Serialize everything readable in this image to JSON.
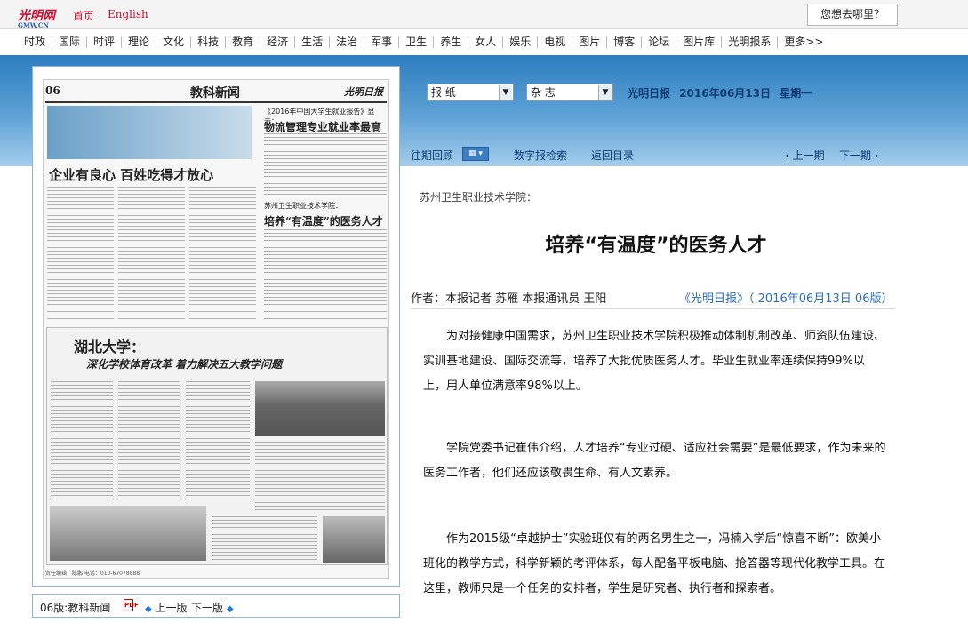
{
  "topbar": {
    "logo_text": "光明网",
    "logo_sub": "GMW.CN",
    "home_label": "首页",
    "english_label": "English",
    "search_label": "您想去哪里？"
  },
  "nav": {
    "items": [
      "时政",
      "国际",
      "时评",
      "理论",
      "文化",
      "科技",
      "教育",
      "经济",
      "生活",
      "法治",
      "军事",
      "卫生",
      "养生",
      "女人",
      "娱乐",
      "电视",
      "图片",
      "博客",
      "论坛",
      "图片库",
      "光明报系",
      "更多>>"
    ]
  },
  "paper": {
    "page_no": "06",
    "section": "教科新闻",
    "masthead": "光明日报",
    "headline1": "企业有良心 百姓吃得才放心",
    "sub2": "《2016年中国大学生就业报告》显示：",
    "headline2": "物流管理专业就业率最高",
    "sub3": "苏州卫生职业技术学院：",
    "headline3": "培养“有温度”的医务人才",
    "hubei_title": "湖北大学：",
    "hubei_sub": "深化学校体育改革  着力解决五大教学问题",
    "footer": "责任编辑：陈鹏 电话：010-67078888"
  },
  "paper_nav": {
    "label": "06版:教科新闻",
    "pdf_icon": "PDF",
    "prev_label": "上一版",
    "next_label": "下一版"
  },
  "selectors": {
    "paper_value": "报 纸",
    "magazine_value": "杂 志"
  },
  "issue": {
    "name": "光明日报",
    "date": "2016年06月13日",
    "weekday": "星期一"
  },
  "toolbar": {
    "past_label": "往期回顾",
    "search_label": "数字报检索",
    "index_label": "返回目录",
    "prev_label": "上一期",
    "next_label": "下一期"
  },
  "article": {
    "kicker": "苏州卫生职业技术学院：",
    "title": "培养“有温度”的医务人才",
    "byline": "作者：本报记者 苏雁 本报通讯员 王阳",
    "source": "《光明日报》（ 2016年06月13日 06版）",
    "paragraphs": [
      "为对接健康中国需求，苏州卫生职业技术学院积极推动体制机制改革、师资队伍建设、实训基地建设、国际交流等，培养了大批优质医务人才。毕业生就业率连续保持99%以上，用人单位满意率98%以上。",
      "学院党委书记崔伟介绍，人才培养“专业过硬、适应社会需要”是最低要求，作为未来的医务工作者，他们还应该敬畏生命、有人文素养。",
      "作为2015级“卓越护士”实验班仅有的两名男生之一，冯楠入学后“惊喜不断”：欧美小班化的教学方式，科学新颖的考评体系，每人配备平板电脑、抢答器等现代化教学工具。在这里，教师只是一个任务的安排者，学生是研究者、执行者和探索者。"
    ]
  }
}
